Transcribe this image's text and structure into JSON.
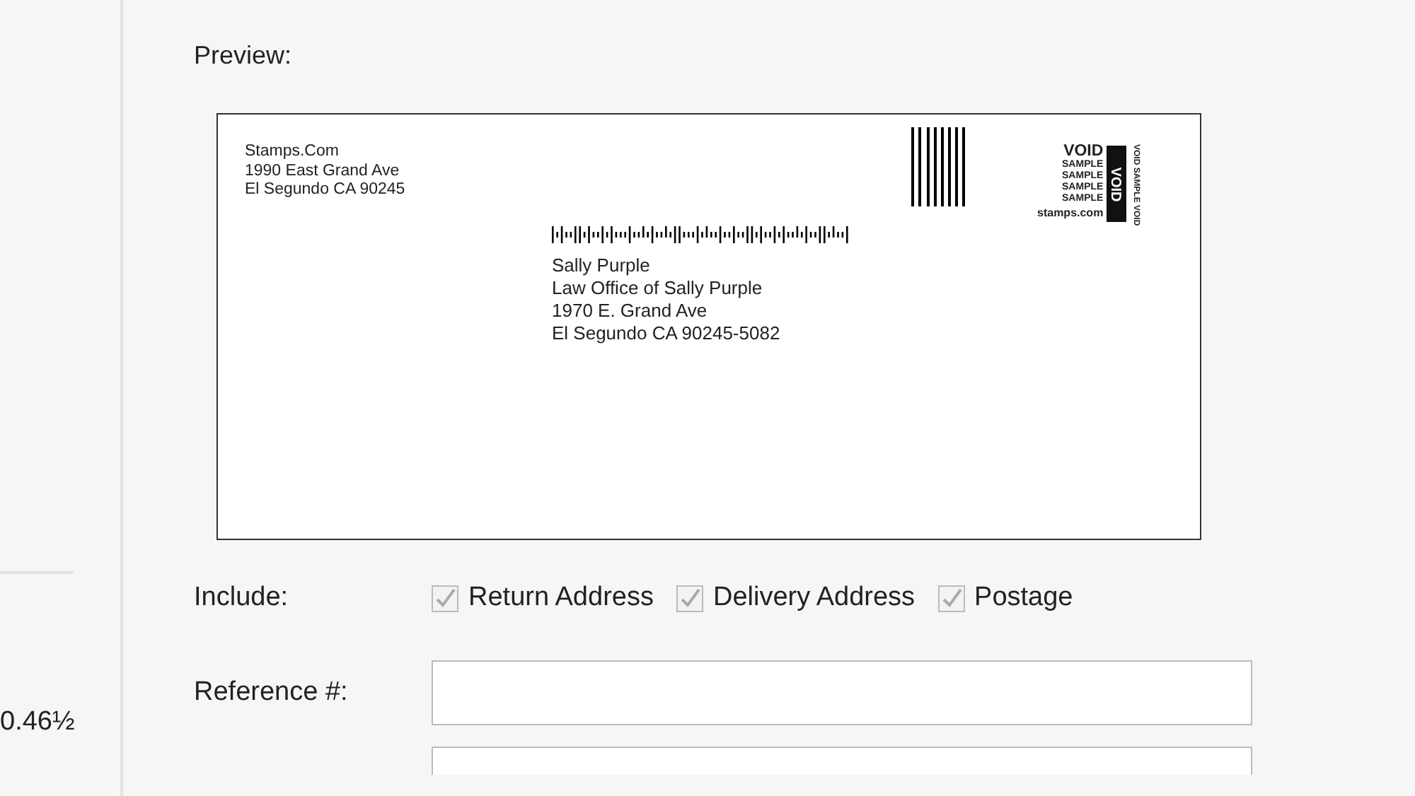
{
  "sidebar": {
    "amount": "0.46½"
  },
  "preview": {
    "label": "Preview:",
    "return_address": [
      "Stamps.Com",
      "1990 East Grand Ave",
      "El Segundo CA 90245"
    ],
    "stamp": {
      "void": "VOID",
      "samples": [
        "SAMPLE",
        "SAMPLE",
        "SAMPLE",
        "SAMPLE"
      ],
      "block_text": "VOID",
      "side_text": "VOID SAMPLE VOID",
      "logo": "stamps.com"
    },
    "delivery_address": [
      "Sally Purple",
      "Law Office of Sally Purple",
      "1970 E. Grand Ave",
      "El Segundo CA 90245-5082"
    ]
  },
  "include": {
    "label": "Include:",
    "options": [
      {
        "label": "Return Address",
        "checked": true
      },
      {
        "label": "Delivery Address",
        "checked": true
      },
      {
        "label": "Postage",
        "checked": true
      }
    ]
  },
  "reference": {
    "label": "Reference #:"
  }
}
